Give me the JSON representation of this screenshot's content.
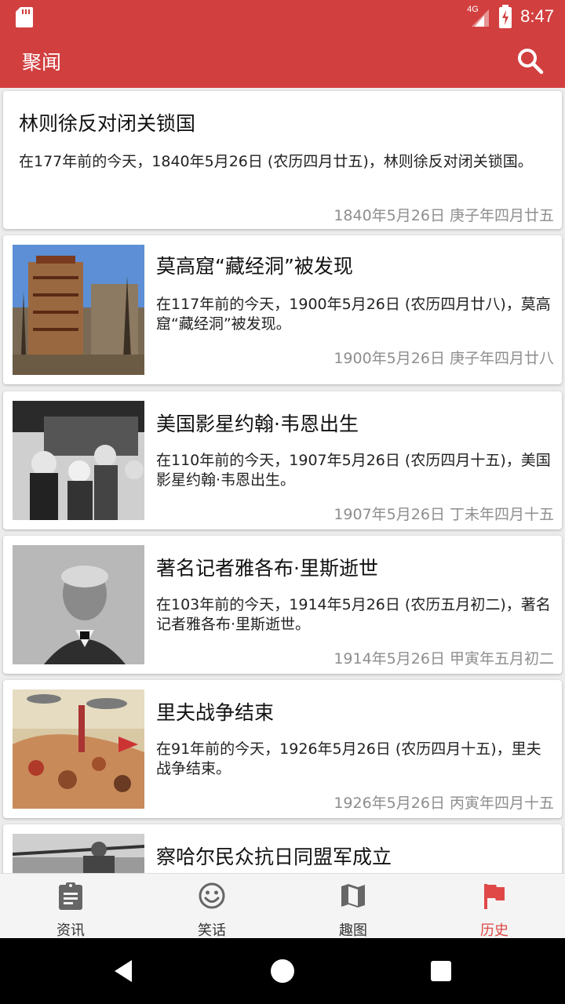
{
  "status_bar": {
    "time": "8:47",
    "network": "4G"
  },
  "app_bar": {
    "title": "聚闻"
  },
  "articles": [
    {
      "title": "林则徐反对闭关锁国",
      "summary": "在177年前的今天，1840年5月26日 (农历四月廿五)，林则徐反对闭关锁国。",
      "date": "1840年5月26日  庚子年四月廿五"
    },
    {
      "title": "莫高窟“藏经洞”被发现",
      "summary": "在117年前的今天，1900年5月26日 (农历四月廿八)，莫高窟“藏经洞”被发现。",
      "date": "1900年5月26日  庚子年四月廿八"
    },
    {
      "title": "美国影星约翰·韦恩出生",
      "summary": "在110年前的今天，1907年5月26日 (农历四月十五)，美国影星约翰·韦恩出生。",
      "date": "1907年5月26日  丁未年四月十五"
    },
    {
      "title": "著名记者雅各布·里斯逝世",
      "summary": "在103年前的今天，1914年5月26日 (农历五月初二)，著名记者雅各布·里斯逝世。",
      "date": "1914年5月26日  甲寅年五月初二"
    },
    {
      "title": "里夫战争结束",
      "summary": "在91年前的今天，1926年5月26日 (农历四月十五)，里夫战争结束。",
      "date": "1926年5月26日  丙寅年四月十五"
    },
    {
      "title": "察哈尔民众抗日同盟军成立"
    }
  ],
  "bottom_nav": [
    {
      "label": "资讯",
      "icon": "clipboard-icon"
    },
    {
      "label": "笑话",
      "icon": "smiley-icon"
    },
    {
      "label": "趣图",
      "icon": "map-icon"
    },
    {
      "label": "历史",
      "icon": "flag-icon",
      "active": true
    }
  ],
  "colors": {
    "primary": "#d23f3f",
    "accent": "#e04848"
  }
}
